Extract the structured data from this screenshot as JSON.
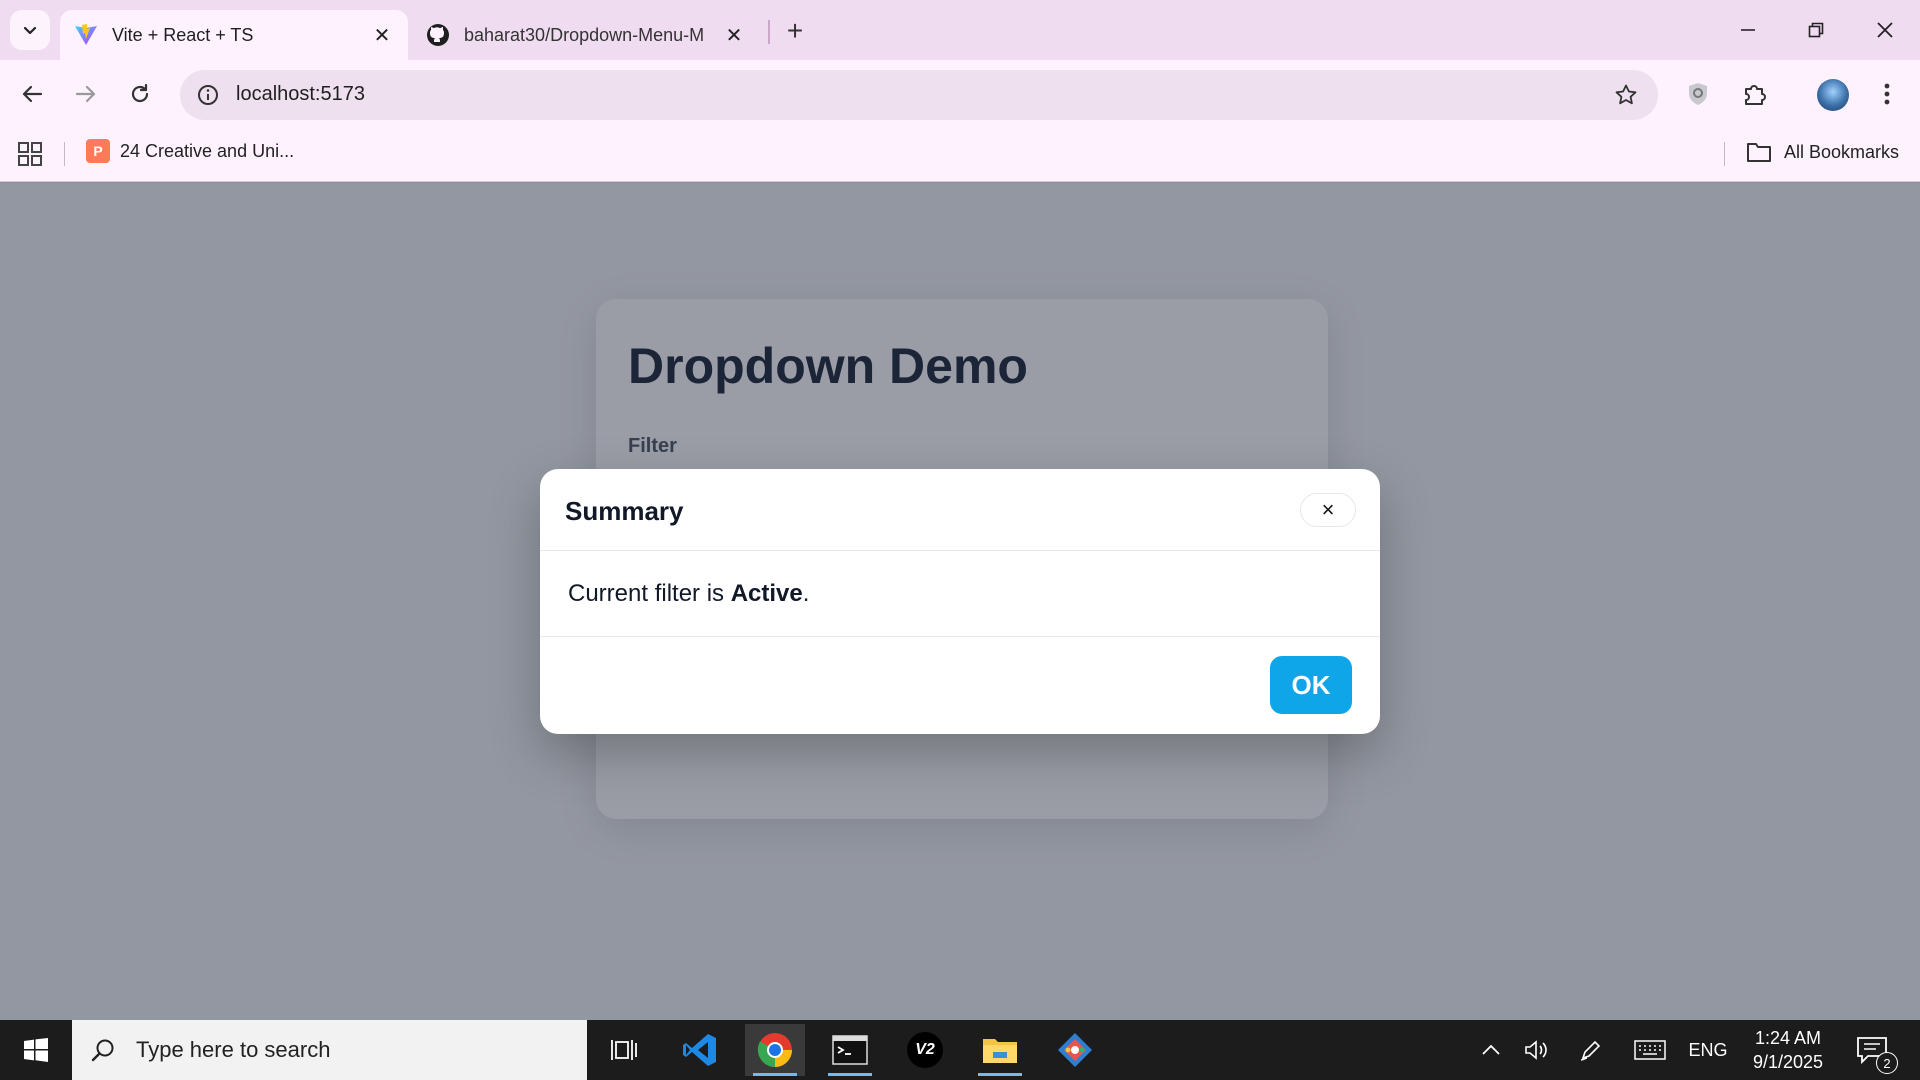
{
  "browser": {
    "tabs": [
      {
        "title": "Vite + React + TS",
        "active": true
      },
      {
        "title": "baharat30/Dropdown-Menu-M",
        "active": false
      }
    ],
    "address": "localhost:5173",
    "bookmarks": [
      {
        "label": "24 Creative and Uni...",
        "favicon": "P"
      }
    ],
    "all_bookmarks_label": "All Bookmarks"
  },
  "page": {
    "title": "Dropdown Demo",
    "filter_label": "Filter"
  },
  "modal": {
    "title": "Summary",
    "close_glyph": "×",
    "text_prefix": "Current filter is ",
    "filter_value": "Active",
    "text_suffix": ".",
    "ok_label": "OK"
  },
  "taskbar": {
    "search_placeholder": "Type here to search",
    "language": "ENG",
    "time": "1:24 AM",
    "date": "9/1/2025",
    "notification_count": "2",
    "v2_label": "V2"
  },
  "colors": {
    "accent": "#0ea5e9",
    "tabstrip": "#f0dcf0",
    "heading": "#1a2438"
  }
}
